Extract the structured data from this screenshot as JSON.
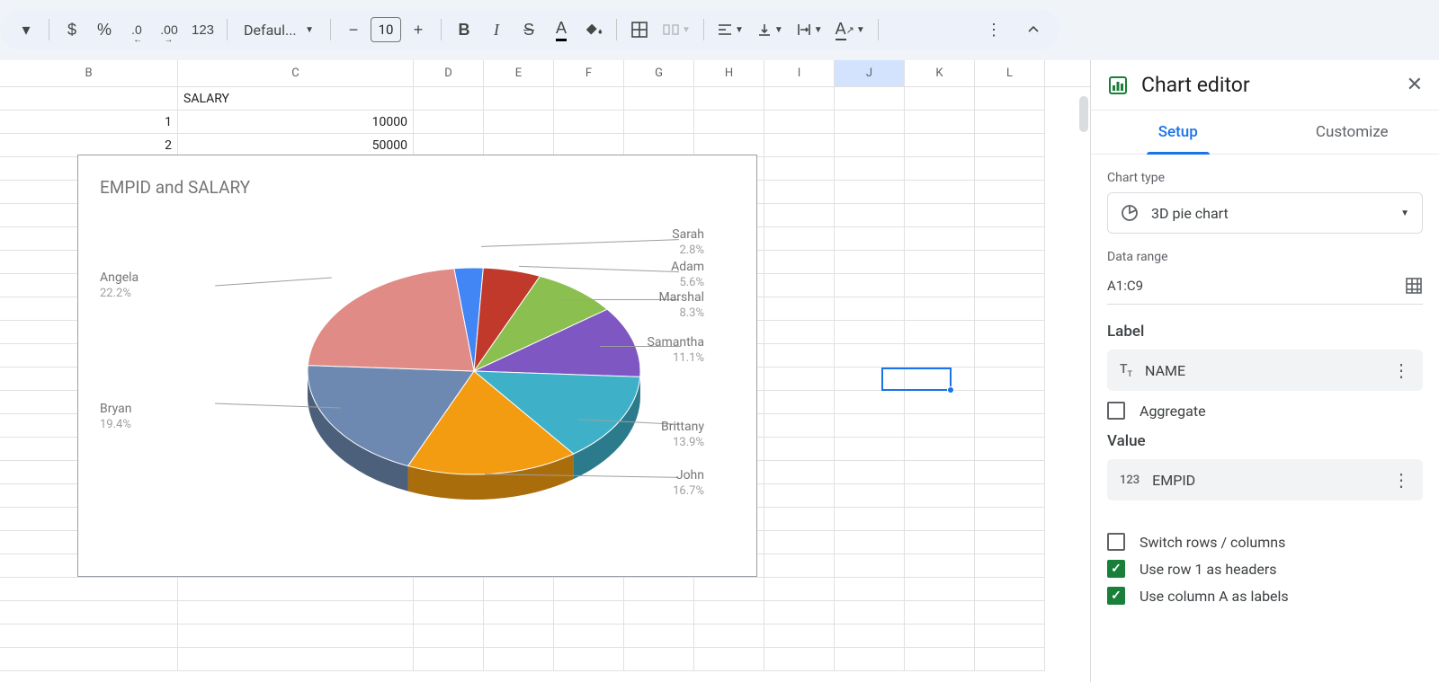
{
  "toolbar": {
    "currency_icon": "$",
    "percent_icon": "%",
    "dec_minus": ".0",
    "dec_plus": ".00",
    "num_fmt": "123",
    "font_name": "Defaul...",
    "font_size": "10"
  },
  "columns": [
    "B",
    "C",
    "D",
    "E",
    "F",
    "G",
    "H",
    "I",
    "J",
    "K",
    "L"
  ],
  "cells": {
    "c1": "SALARY",
    "b2": "1",
    "c2": "10000",
    "b3": "2",
    "c3": "50000"
  },
  "chart": {
    "title": "EMPID and SALARY",
    "labels": {
      "angela": "Angela",
      "angela_pct": "22.2%",
      "bryan": "Bryan",
      "bryan_pct": "19.4%",
      "sarah": "Sarah",
      "sarah_pct": "2.8%",
      "adam": "Adam",
      "adam_pct": "5.6%",
      "marshal": "Marshal",
      "marshal_pct": "8.3%",
      "samantha": "Samantha",
      "samantha_pct": "11.1%",
      "brittany": "Brittany",
      "brittany_pct": "13.9%",
      "john": "John",
      "john_pct": "16.7%"
    }
  },
  "chart_data": {
    "type": "pie",
    "title": "EMPID and SALARY",
    "series": [
      {
        "name": "Sarah",
        "value": 2.8,
        "color": "#4285f4"
      },
      {
        "name": "Adam",
        "value": 5.6,
        "color": "#c0392b"
      },
      {
        "name": "Marshal",
        "value": 8.3,
        "color": "#8bbf4f"
      },
      {
        "name": "Samantha",
        "value": 11.1,
        "color": "#7e57c2"
      },
      {
        "name": "Brittany",
        "value": 13.9,
        "color": "#3eb1c8"
      },
      {
        "name": "John",
        "value": 16.7,
        "color": "#f39c12"
      },
      {
        "name": "Bryan",
        "value": 19.4,
        "color": "#6d89b1"
      },
      {
        "name": "Angela",
        "value": 22.2,
        "color": "#e08b86"
      }
    ],
    "three_d": true
  },
  "sidebar": {
    "title": "Chart editor",
    "tab_setup": "Setup",
    "tab_customize": "Customize",
    "chart_type_lbl": "Chart type",
    "chart_type_val": "3D pie chart",
    "range_lbl": "Data range",
    "range_val": "A1:C9",
    "label_lbl": "Label",
    "label_val": "NAME",
    "aggregate": "Aggregate",
    "value_lbl": "Value",
    "value_val": "EMPID",
    "switch_rc": "Switch rows / columns",
    "row1_headers": "Use row 1 as headers",
    "colA_labels": "Use column A as labels"
  }
}
